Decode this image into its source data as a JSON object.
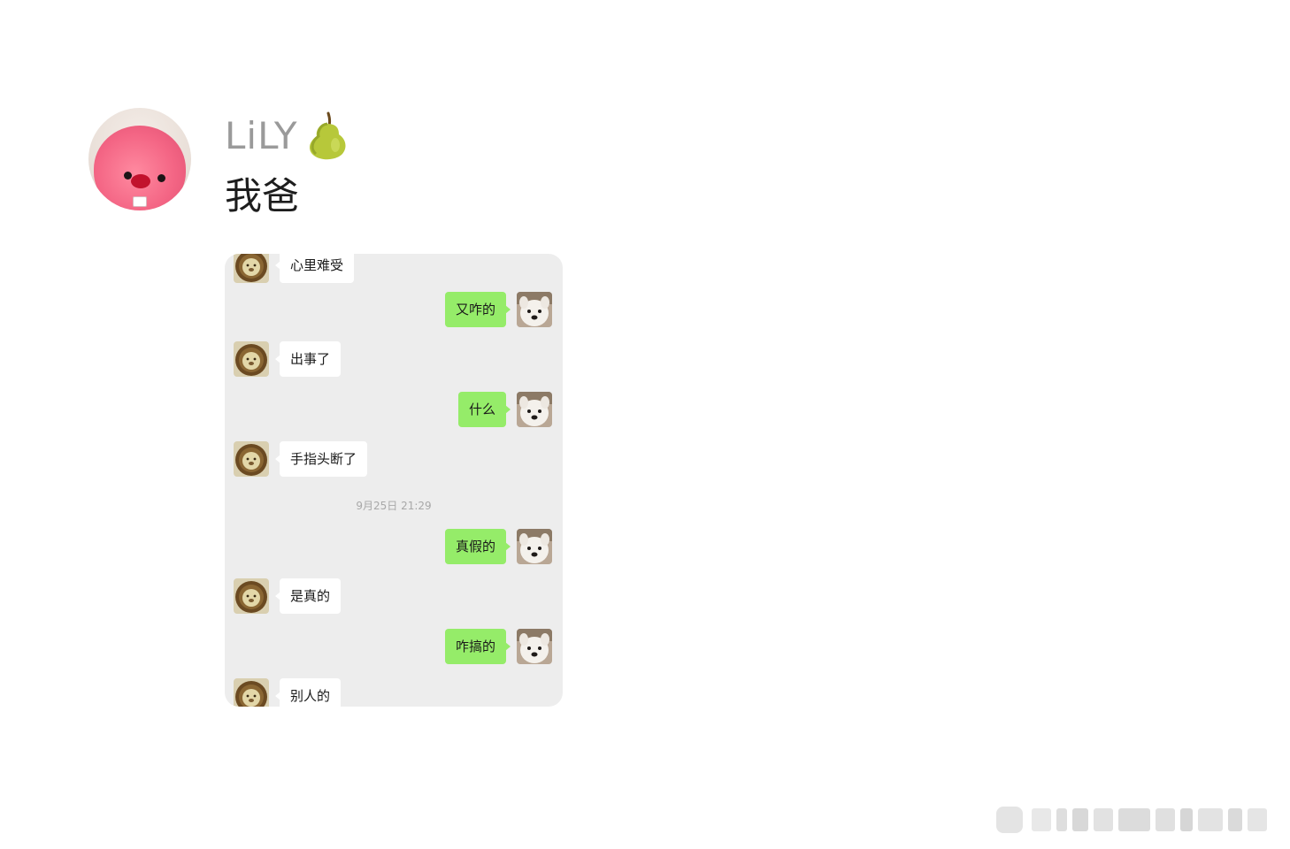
{
  "post": {
    "username": "LiLY",
    "username_emoji_icon": "pear-icon",
    "avatar_icon": "pink-plush-avatar-icon",
    "text": "我爸"
  },
  "chat": {
    "timestamp": "9月25日 21:29",
    "colors": {
      "background": "#ededed",
      "sent_bubble": "#95ec69",
      "received_bubble": "#ffffff"
    },
    "messages": [
      {
        "side": "left",
        "text": "心里难受",
        "avatar_icon": "lion-avatar-icon"
      },
      {
        "side": "right",
        "text": "又咋的",
        "avatar_icon": "dog-avatar-icon"
      },
      {
        "side": "left",
        "text": "出事了",
        "avatar_icon": "lion-avatar-icon"
      },
      {
        "side": "right",
        "text": "什么",
        "avatar_icon": "dog-avatar-icon"
      },
      {
        "side": "left",
        "text": "手指头断了",
        "avatar_icon": "lion-avatar-icon"
      },
      {
        "side": "right",
        "text": "真假的",
        "avatar_icon": "dog-avatar-icon"
      },
      {
        "side": "left",
        "text": "是真的",
        "avatar_icon": "lion-avatar-icon"
      },
      {
        "side": "right",
        "text": "咋搞的",
        "avatar_icon": "dog-avatar-icon"
      },
      {
        "side": "left",
        "text": "别人的",
        "avatar_icon": "lion-avatar-icon"
      }
    ]
  },
  "watermark_icon": "blurred-watermark-icon"
}
